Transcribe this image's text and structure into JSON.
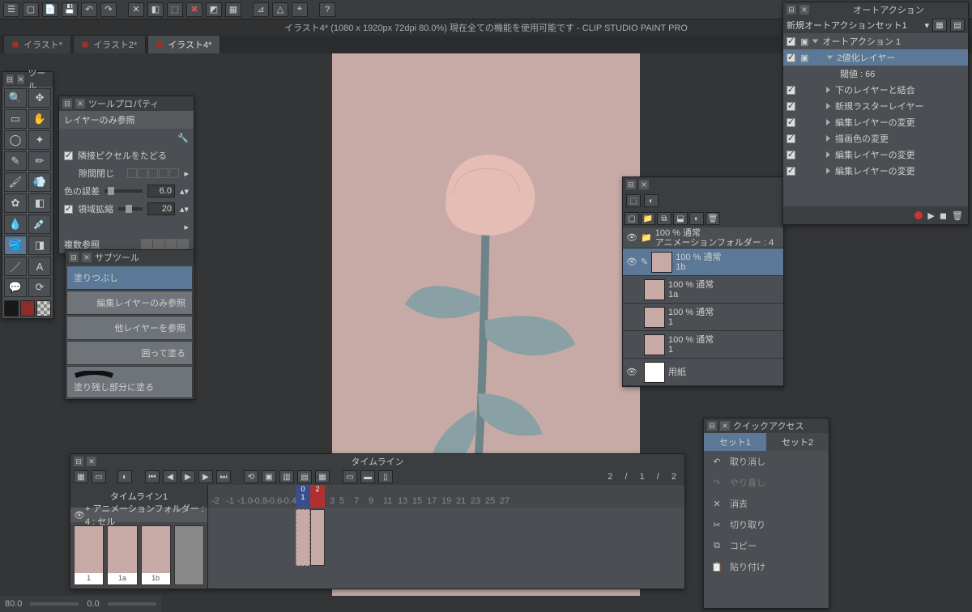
{
  "app": {
    "title": "イラスト4* (1080 x 1920px 72dpi 80.0%)  現在全ての機能を使用可能です - CLIP STUDIO PAINT PRO"
  },
  "tabs": {
    "t1": "イラスト*",
    "t2": "イラスト2*",
    "t3": "イラスト4*"
  },
  "tool_panel": {
    "title": "ツール"
  },
  "tool_prop": {
    "title": "ツールプロパティ",
    "ref_label": "レイヤーのみ参照",
    "adj_pixel": "隣接ピクセルをたどる",
    "gap_close": "隙間閉じ",
    "color_tol": "色の誤差",
    "color_tol_val": "6.0",
    "area_exp": "領域拡縮",
    "area_exp_val": "20",
    "multi_ref": "複数参照"
  },
  "subtool": {
    "title": "サブツール",
    "items": {
      "a": "塗りつぶし",
      "b": "編集レイヤーのみ参照",
      "c": "他レイヤーを参照",
      "d": "囲って塗る",
      "e": "塗り残し部分に塗る"
    }
  },
  "timeline": {
    "title": "タイムライン",
    "name": "タイムライン1",
    "folder": "+ アニメーションフォルダー : 4 : セル",
    "counter": "2   /   1   /   2",
    "cels": {
      "a": "1",
      "b": "1a",
      "c": "1b",
      "d": ""
    }
  },
  "layers": {
    "folder_opacity": "100 % 通常",
    "folder_name": "アニメーションフォルダー : 4",
    "l1_op": "100 % 通常",
    "l1": "1b",
    "l2_op": "100 % 通常",
    "l2": "1a",
    "l3_op": "100 % 通常",
    "l3": "1",
    "l4_op": "100 % 通常",
    "l4": "1",
    "paper": "用紙"
  },
  "quick": {
    "title": "クイックアクセス",
    "set1": "セット1",
    "set2": "セット2",
    "undo": "取り消し",
    "redo": "やり直し",
    "clear": "消去",
    "cut": "切り取り",
    "copy": "コピー",
    "paste": "貼り付け"
  },
  "autoaction": {
    "title": "オートアクション",
    "setname": "新規オートアクションセット1",
    "root": "オートアクション 1",
    "a": "2値化レイヤー",
    "a_param": "閾値 : 66",
    "b": "下のレイヤーと結合",
    "c": "新規ラスターレイヤー",
    "d": "編集レイヤーの変更",
    "e": "描画色の変更",
    "f": "編集レイヤーの変更",
    "g": "編集レイヤーの変更"
  },
  "status": {
    "zoom": "80.0",
    "angle": "0.0"
  }
}
